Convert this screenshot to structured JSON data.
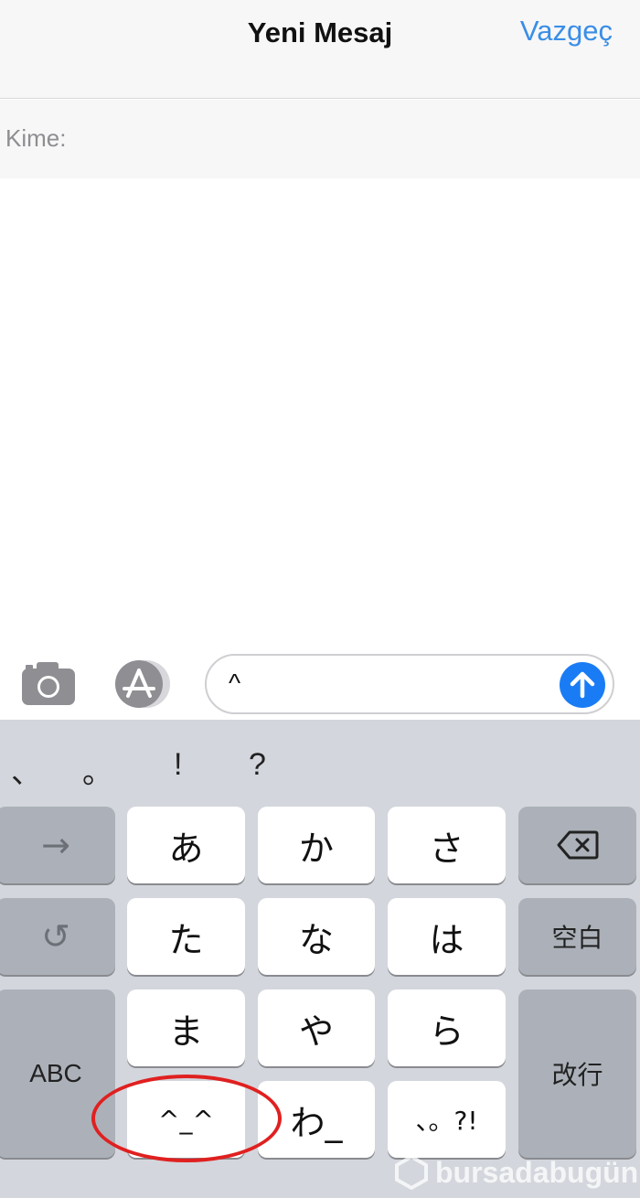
{
  "nav": {
    "title": "Yeni Mesaj",
    "cancel": "Vazgeç"
  },
  "to": {
    "label": "Kime:",
    "value": ""
  },
  "input_bar": {
    "message_text": "^"
  },
  "keyboard": {
    "candidates": [
      "、",
      "。",
      "!",
      "?"
    ],
    "keys": {
      "next": "→",
      "a": "あ",
      "ka": "か",
      "sa": "さ",
      "undo": "↺",
      "ta": "た",
      "na": "な",
      "ha": "は",
      "space": "空白",
      "abc": "ABC",
      "ma": "ま",
      "ya": "や",
      "ra": "ら",
      "enter": "改行",
      "emoticon": "^_^",
      "wa": "わ_",
      "punct": "、。?!"
    }
  },
  "watermark": "bursadabugün",
  "colors": {
    "accent": "#3a8ee6",
    "send": "#1a7cf5",
    "highlight": "#e02020",
    "keyboard_bg": "#d3d6dc"
  }
}
